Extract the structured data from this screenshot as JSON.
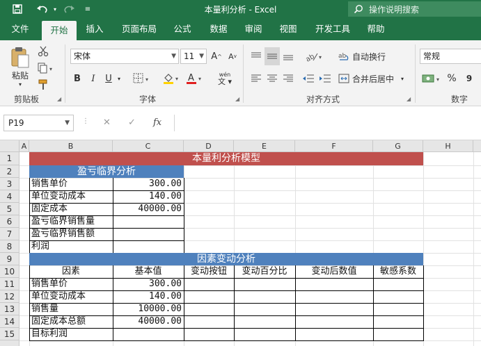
{
  "window": {
    "title": "本量利分析 - Excel",
    "search_placeholder": "操作说明搜索"
  },
  "tabs": [
    "文件",
    "开始",
    "插入",
    "页面布局",
    "公式",
    "数据",
    "审阅",
    "视图",
    "开发工具",
    "帮助"
  ],
  "active_tab": "开始",
  "ribbon": {
    "clipboard": {
      "paste": "粘贴",
      "label": "剪贴板"
    },
    "font": {
      "name": "宋体",
      "size": "11",
      "grow": "A",
      "shrink": "A",
      "bold": "B",
      "italic": "I",
      "underline": "U",
      "color_a": "A",
      "phonetic": "wén",
      "label": "字体"
    },
    "alignment": {
      "wrap": "自动换行",
      "merge": "合并后居中",
      "label": "对齐方式"
    },
    "number": {
      "format": "常规",
      "percent": "%",
      "comma": "9",
      "label": "数字"
    }
  },
  "formula_bar": {
    "name_box": "P19",
    "fx": "fx",
    "value": ""
  },
  "columns": [
    "A",
    "B",
    "C",
    "D",
    "E",
    "F",
    "G",
    "H"
  ],
  "rows": [
    "1",
    "2",
    "3",
    "4",
    "5",
    "6",
    "7",
    "8",
    "9",
    "10",
    "11",
    "12",
    "13",
    "14",
    "15"
  ],
  "sheet": {
    "title": "本量利分析模型",
    "section1": {
      "header": "盈亏临界分析",
      "rows": [
        {
          "label": "销售单价",
          "value": "300.00"
        },
        {
          "label": "单位变动成本",
          "value": "140.00"
        },
        {
          "label": "固定成本",
          "value": "40000.00"
        },
        {
          "label": "盈亏临界销售量",
          "value": ""
        },
        {
          "label": "盈亏临界销售额",
          "value": ""
        },
        {
          "label": "利润",
          "value": ""
        }
      ]
    },
    "section2": {
      "header": "因素变动分析",
      "col_headers": [
        "因素",
        "基本值",
        "变动按钮",
        "变动百分比",
        "变动后数值",
        "敏感系数"
      ],
      "rows": [
        {
          "label": "销售单价",
          "value": "300.00"
        },
        {
          "label": "单位变动成本",
          "value": "140.00"
        },
        {
          "label": "销售量",
          "value": "10000.00"
        },
        {
          "label": "固定成本总额",
          "value": "40000.00"
        },
        {
          "label": "目标利润",
          "value": ""
        }
      ]
    }
  },
  "colors": {
    "excel_green": "#217346",
    "title_band": "#c0504d",
    "section_band": "#4f81bd"
  }
}
